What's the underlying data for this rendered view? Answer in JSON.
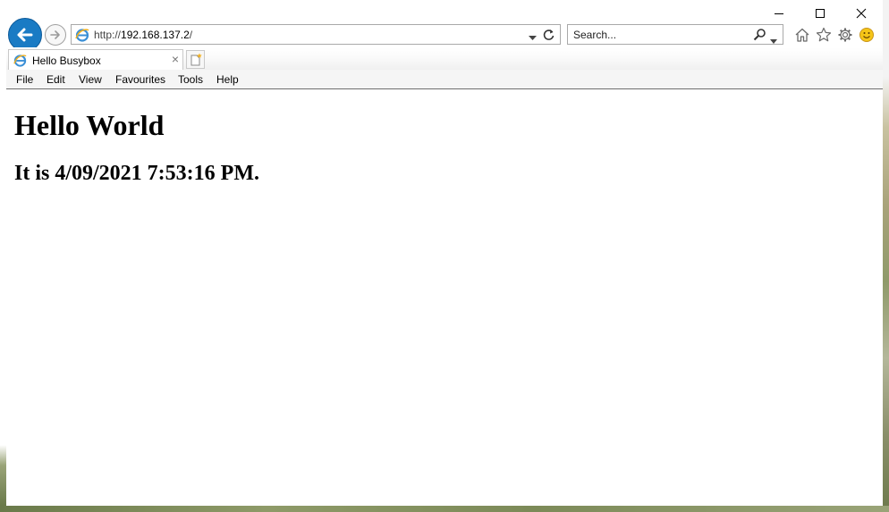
{
  "browser": {
    "address": {
      "scheme": "http://",
      "host": "192.168.137.2",
      "path": "/"
    },
    "search": {
      "placeholder": "Search..."
    },
    "tab": {
      "title": "Hello Busybox",
      "close_glyph": "×"
    },
    "menu": [
      "File",
      "Edit",
      "View",
      "Favourites",
      "Tools",
      "Help"
    ],
    "colors": {
      "back_button": "#1a7bc4",
      "smiley": "#f5c518"
    },
    "icons": [
      "back-arrow-icon",
      "forward-arrow-icon",
      "ie-logo-icon",
      "refresh-icon",
      "search-icon",
      "home-icon",
      "favorites-star-icon",
      "settings-gear-icon",
      "feedback-smiley-icon",
      "new-tab-icon",
      "minimize-icon",
      "maximize-icon",
      "close-icon"
    ]
  },
  "page": {
    "heading": "Hello World",
    "subheading": "It is 4/09/2021 7:53:16 PM."
  }
}
